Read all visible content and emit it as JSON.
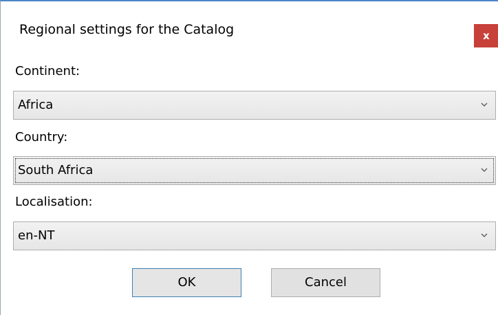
{
  "window": {
    "title": "Regional settings for the Catalog",
    "close_label": "x"
  },
  "continent": {
    "label": "Continent:",
    "value": "Africa"
  },
  "country": {
    "label": "Country:",
    "value": "South Africa"
  },
  "localisation": {
    "label": "Localisation:",
    "value": "en-NT"
  },
  "buttons": {
    "ok_label": "OK",
    "cancel_label": "Cancel"
  },
  "icons": {
    "close": "close-icon",
    "dropdown": "chevron-down-icon"
  },
  "colors": {
    "close_button": "#c7403a",
    "title_border": "#4a86c8",
    "default_button_border": "#3c7fb1"
  }
}
